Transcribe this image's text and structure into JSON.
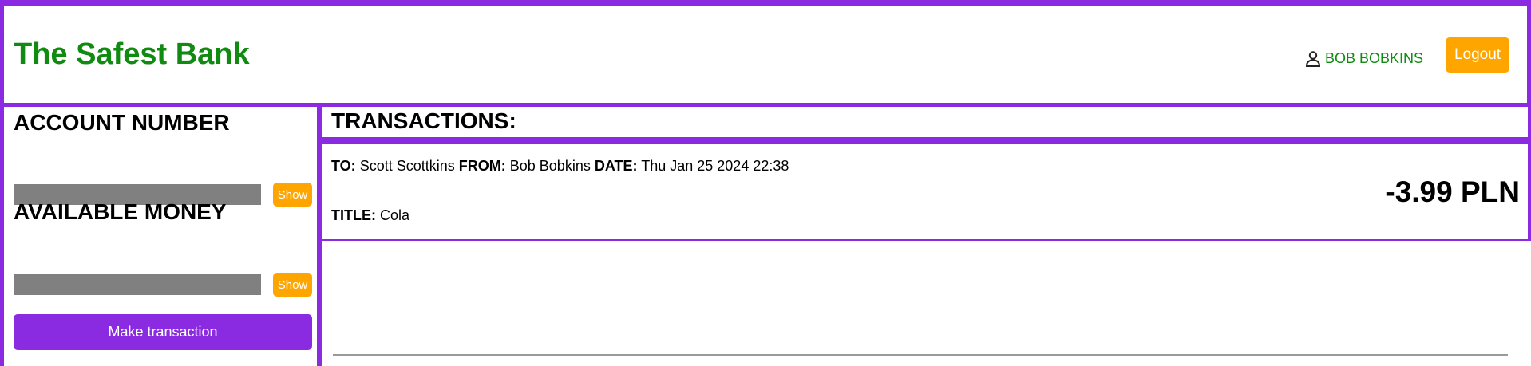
{
  "header": {
    "brand": "The Safest Bank",
    "user_name": "BOB BOBKINS",
    "user_icon": "person-icon",
    "logout_label": "Logout"
  },
  "sidebar": {
    "account_heading": "ACCOUNT NUMBER",
    "money_heading": "AVAILABLE MONEY",
    "show_label": "Show",
    "make_transaction_label": "Make transaction"
  },
  "transactions": {
    "heading": "TRANSACTIONS:",
    "items": [
      {
        "to_label": "TO:",
        "to": "Scott Scottkins",
        "from_label": "FROM:",
        "from": "Bob Bobkins",
        "date_label": "DATE:",
        "date": "Thu Jan 25 2024 22:38",
        "title_label": "TITLE:",
        "title": "Cola",
        "amount": "-3.99 PLN"
      }
    ]
  },
  "colors": {
    "accent": "#8a2be2",
    "brand": "#118a11",
    "button": "#ffa500",
    "masked": "#808080"
  }
}
